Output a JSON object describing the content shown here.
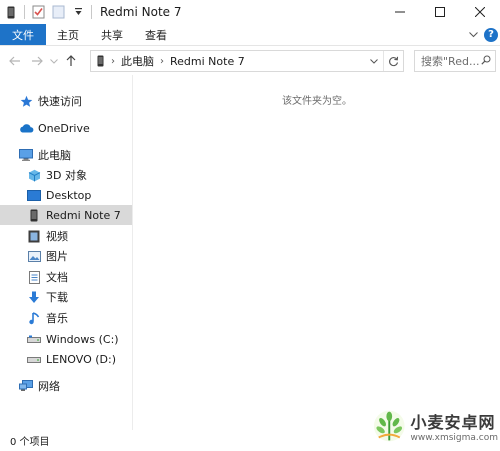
{
  "window": {
    "title": "Redmi Note 7"
  },
  "ribbon": {
    "tabs": [
      {
        "label": "文件"
      },
      {
        "label": "主页"
      },
      {
        "label": "共享"
      },
      {
        "label": "查看"
      }
    ]
  },
  "address": {
    "crumbs": [
      "此电脑",
      "Redmi Note 7"
    ]
  },
  "search": {
    "placeholder": "搜索\"Red..."
  },
  "nav": {
    "items": [
      {
        "label": "快速访问",
        "icon": "star-icon"
      },
      {
        "label": "OneDrive",
        "icon": "cloud-icon"
      },
      {
        "label": "此电脑",
        "icon": "computer-icon"
      },
      {
        "label": "3D 对象",
        "icon": "cube-icon"
      },
      {
        "label": "Desktop",
        "icon": "desktop-icon"
      },
      {
        "label": "Redmi Note 7",
        "icon": "phone-icon",
        "selected": true
      },
      {
        "label": "视频",
        "icon": "video-icon"
      },
      {
        "label": "图片",
        "icon": "picture-icon"
      },
      {
        "label": "文档",
        "icon": "document-icon"
      },
      {
        "label": "下载",
        "icon": "download-icon"
      },
      {
        "label": "音乐",
        "icon": "music-icon"
      },
      {
        "label": "Windows (C:)",
        "icon": "drive-icon"
      },
      {
        "label": "LENOVO (D:)",
        "icon": "drive-icon"
      },
      {
        "label": "网络",
        "icon": "network-icon"
      }
    ]
  },
  "content": {
    "empty_message": "该文件夹为空。"
  },
  "status": {
    "item_count": "0 个项目"
  },
  "watermark": {
    "name": "小麦安卓网",
    "url": "www.xmsigma.com"
  },
  "colors": {
    "accent": "#1e73c8",
    "selected_row": "#d9d9d9"
  }
}
